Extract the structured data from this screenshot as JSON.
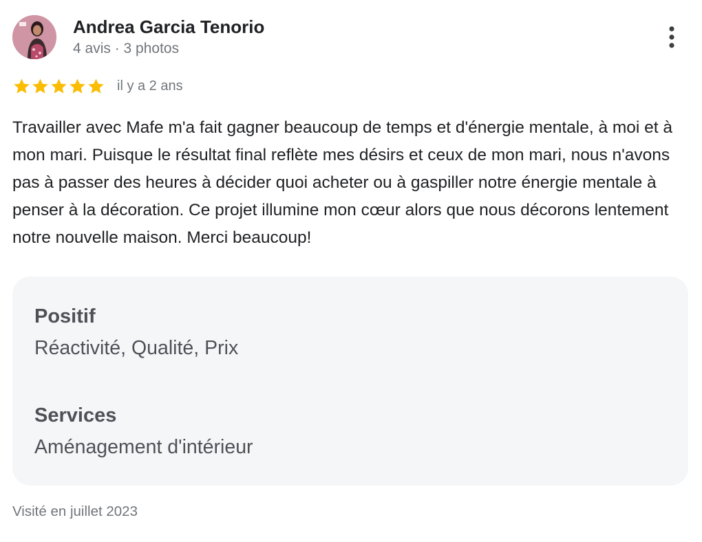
{
  "author": {
    "name": "Andrea Garcia Tenorio",
    "meta": "4 avis · 3 photos"
  },
  "rating": {
    "stars": 5,
    "max": 5,
    "star_color": "#fbbc04",
    "date": "il y a 2 ans"
  },
  "review": {
    "text": "Travailler avec Mafe m'a fait gagner beaucoup de temps et d'énergie mentale, à moi et à mon mari. Puisque le résultat final reflète mes désirs et ceux de mon mari, nous n'avons pas à passer des heures à décider quoi acheter ou à gaspiller notre énergie mentale à penser à la décoration. Ce projet illumine mon cœur alors que nous décorons lentement notre nouvelle maison. Merci beaucoup!"
  },
  "attributes": {
    "positive_title": "Positif",
    "positive_value": "Réactivité, Qualité, Prix",
    "services_title": "Services",
    "services_value": "Aménagement d'intérieur"
  },
  "visit": {
    "text": "Visité en juillet 2023"
  },
  "icons": {
    "more": "more-vert-icon",
    "star": "star-icon"
  }
}
